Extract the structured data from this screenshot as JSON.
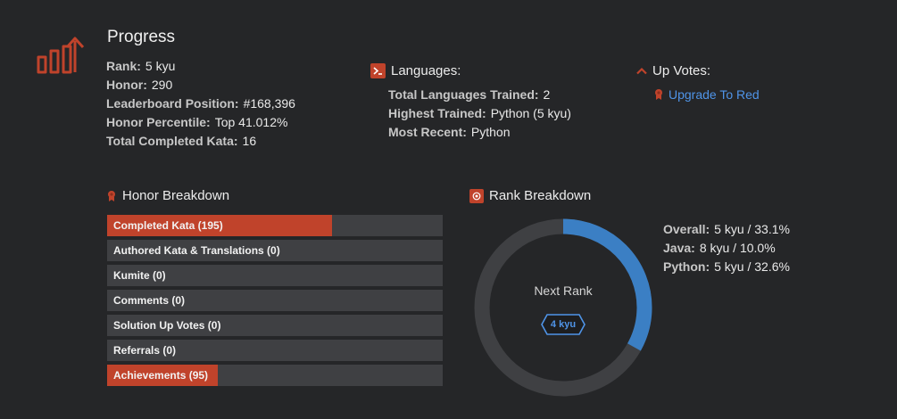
{
  "progress": {
    "title": "Progress",
    "stats": [
      {
        "label": "Rank:",
        "value": "5 kyu"
      },
      {
        "label": "Honor:",
        "value": "290"
      },
      {
        "label": "Leaderboard Position:",
        "value": "#168,396"
      },
      {
        "label": "Honor Percentile:",
        "value": "Top 41.012%"
      },
      {
        "label": "Total Completed Kata:",
        "value": "16"
      }
    ]
  },
  "languages": {
    "title": "Languages:",
    "stats": [
      {
        "label": "Total Languages Trained:",
        "value": "2"
      },
      {
        "label": "Highest Trained:",
        "value": "Python (5 kyu)"
      },
      {
        "label": "Most Recent:",
        "value": "Python"
      }
    ]
  },
  "upvotes": {
    "title": "Up Votes:",
    "link": "Upgrade To Red"
  },
  "honor_breakdown": {
    "title": "Honor Breakdown",
    "bars": [
      {
        "label": "Completed Kata (195)",
        "fill": 0.67
      },
      {
        "label": "Authored Kata & Translations (0)",
        "fill": 0
      },
      {
        "label": "Kumite (0)",
        "fill": 0
      },
      {
        "label": "Comments (0)",
        "fill": 0
      },
      {
        "label": "Solution Up Votes (0)",
        "fill": 0
      },
      {
        "label": "Referrals (0)",
        "fill": 0
      },
      {
        "label": "Achievements (95)",
        "fill": 0.33
      }
    ]
  },
  "rank_breakdown": {
    "title": "Rank Breakdown",
    "center_label": "Next Rank",
    "next_rank": "4 kyu",
    "progress": 0.331,
    "stats": [
      {
        "label": "Overall:",
        "value": "5 kyu / 33.1%"
      },
      {
        "label": "Java:",
        "value": "8 kyu / 10.0%"
      },
      {
        "label": "Python:",
        "value": "5 kyu / 32.6%"
      }
    ]
  },
  "colors": {
    "background": "#252628",
    "accent_red": "#c0432b",
    "accent_blue": "#3b7fc4",
    "bar_track": "#3f4043",
    "link": "#4f94e8"
  }
}
